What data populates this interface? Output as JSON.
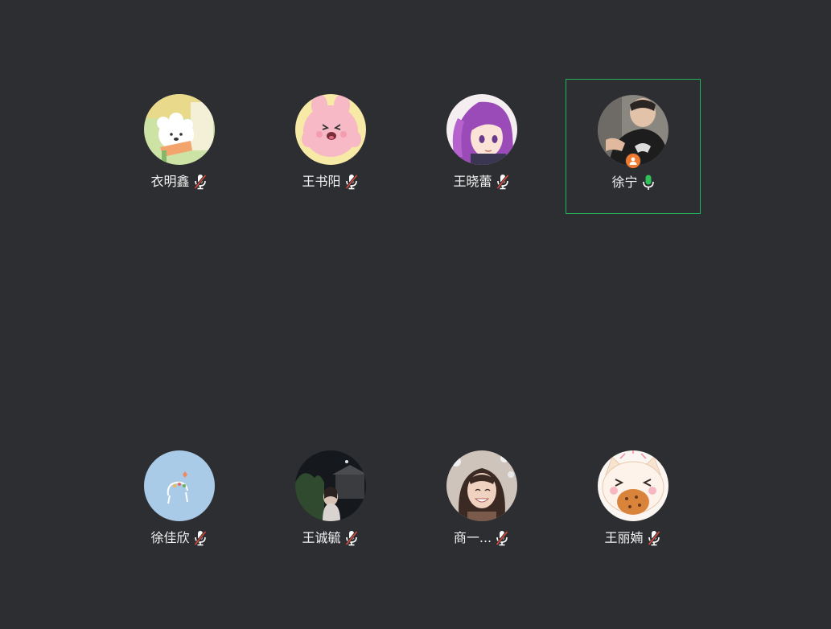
{
  "participants": [
    {
      "name": "衣明鑫",
      "mic": "muted",
      "avatar": "cartoon-dog-avatar",
      "speaking": false,
      "host": false
    },
    {
      "name": "王书阳",
      "mic": "muted",
      "avatar": "pink-bunny-avatar",
      "speaking": false,
      "host": false
    },
    {
      "name": "王晓蕾",
      "mic": "muted",
      "avatar": "anime-girl-avatar",
      "speaking": false,
      "host": false
    },
    {
      "name": "徐宁",
      "mic": "active",
      "avatar": "photo-man-avatar",
      "speaking": true,
      "host": true
    },
    {
      "name": "徐佳欣",
      "mic": "muted",
      "avatar": "blue-doodle-avatar",
      "speaking": false,
      "host": false
    },
    {
      "name": "王诚毓",
      "mic": "muted",
      "avatar": "night-scene-avatar",
      "speaking": false,
      "host": false
    },
    {
      "name": "商一...",
      "mic": "muted",
      "avatar": "photo-woman-avatar",
      "speaking": false,
      "host": false
    },
    {
      "name": "王丽婻",
      "mic": "muted",
      "avatar": "cat-cookie-avatar",
      "speaking": false,
      "host": false
    }
  ],
  "colors": {
    "background": "#2c2e31",
    "speaking_border": "#22b35a",
    "mic_active": "#2fc25b",
    "mic_muted_slash": "#e0483a",
    "host_badge": "#f07a2f",
    "name_text": "#f2f2f2"
  },
  "icons": {
    "mic_muted": "mic-off-icon",
    "mic_active": "mic-on-icon",
    "host": "host-badge-icon"
  }
}
